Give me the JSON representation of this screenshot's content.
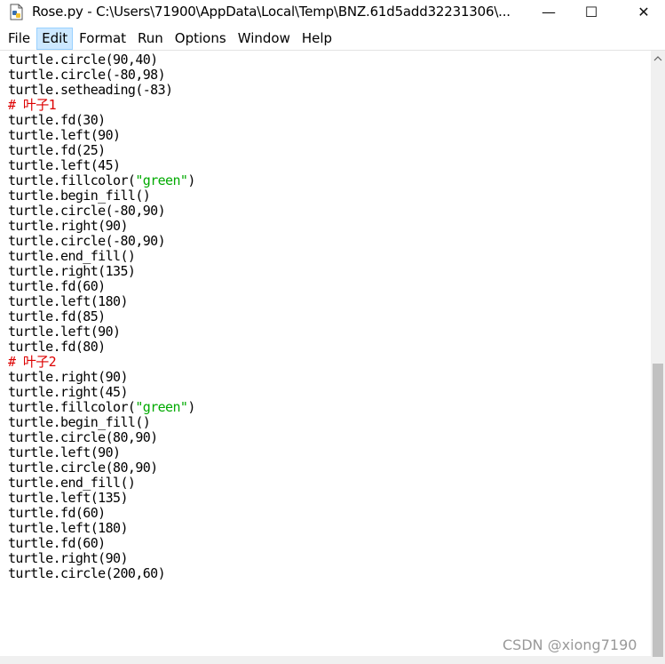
{
  "window": {
    "title": "Rose.py - C:\\Users\\71900\\AppData\\Local\\Temp\\BNZ.61d5add32231306\\...",
    "minimize": "—",
    "maximize": "☐",
    "close": "✕"
  },
  "menu": {
    "items": [
      "File",
      "Edit",
      "Format",
      "Run",
      "Options",
      "Window",
      "Help"
    ],
    "active": "Edit"
  },
  "code": {
    "lines": [
      {
        "text": "turtle.circle(90,40)"
      },
      {
        "text": "turtle.circle(-80,98)"
      },
      {
        "text": "turtle.setheading(-83)"
      },
      {
        "text": "# 叶子1",
        "type": "comment"
      },
      {
        "text": "turtle.fd(30)"
      },
      {
        "text": "turtle.left(90)"
      },
      {
        "text": "turtle.fd(25)"
      },
      {
        "text": "turtle.left(45)"
      },
      {
        "pre": "turtle.fillcolor(",
        "str": "\"green\"",
        "post": ")"
      },
      {
        "text": "turtle.begin_fill()"
      },
      {
        "text": "turtle.circle(-80,90)"
      },
      {
        "text": "turtle.right(90)"
      },
      {
        "text": "turtle.circle(-80,90)"
      },
      {
        "text": "turtle.end_fill()"
      },
      {
        "text": "turtle.right(135)"
      },
      {
        "text": "turtle.fd(60)"
      },
      {
        "text": "turtle.left(180)"
      },
      {
        "text": "turtle.fd(85)"
      },
      {
        "text": "turtle.left(90)"
      },
      {
        "text": "turtle.fd(80)"
      },
      {
        "text": "# 叶子2",
        "type": "comment"
      },
      {
        "text": "turtle.right(90)"
      },
      {
        "text": "turtle.right(45)"
      },
      {
        "pre": "turtle.fillcolor(",
        "str": "\"green\"",
        "post": ")"
      },
      {
        "text": "turtle.begin_fill()"
      },
      {
        "text": "turtle.circle(80,90)"
      },
      {
        "text": "turtle.left(90)"
      },
      {
        "text": "turtle.circle(80,90)"
      },
      {
        "text": "turtle.end_fill()"
      },
      {
        "text": "turtle.left(135)"
      },
      {
        "text": "turtle.fd(60)"
      },
      {
        "text": "turtle.left(180)"
      },
      {
        "text": "turtle.fd(60)"
      },
      {
        "text": "turtle.right(90)"
      },
      {
        "text": "turtle.circle(200,60)"
      }
    ]
  },
  "watermark": "CSDN @xiong7190",
  "colors": {
    "comment": "#dd0000",
    "string": "#00aa00",
    "menu_active_bg": "#cce8ff",
    "scroll_thumb": "#c1c1c1"
  },
  "icons": {
    "app": "python-file-icon",
    "scroll_up": "chevron-up-icon"
  }
}
